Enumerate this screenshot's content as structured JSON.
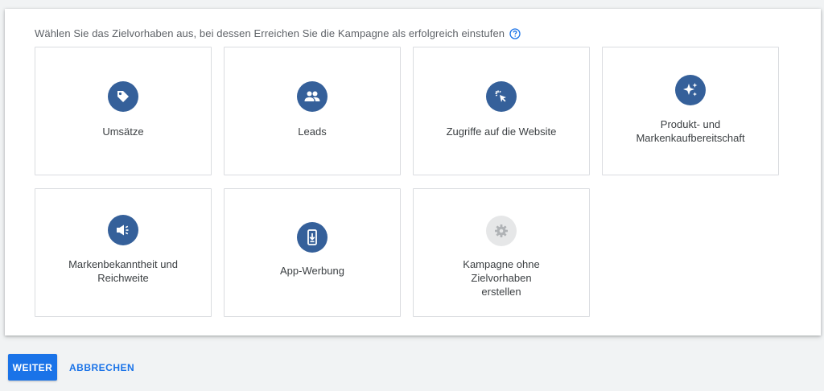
{
  "heading": "Wählen Sie das Zielvorhaben aus, bei dessen Erreichen Sie die Kampagne als erfolgreich einstufen",
  "help_icon": "help-circle-icon",
  "tiles": [
    {
      "label": "Umsätze",
      "icon": "tag-icon"
    },
    {
      "label": "Leads",
      "icon": "people-icon"
    },
    {
      "label": "Zugriffe auf die Website",
      "icon": "cursor-click-icon"
    },
    {
      "label": "Produkt- und\nMarkenkaufbereitschaft",
      "icon": "sparkle-icon"
    },
    {
      "label": "Markenbekanntheit und\nReichweite",
      "icon": "megaphone-icon"
    },
    {
      "label": "App-Werbung",
      "icon": "phone-download-icon"
    },
    {
      "label": "Kampagne ohne Zielvorhaben\nerstellen",
      "icon": "gear-icon"
    }
  ],
  "actions": {
    "continue_label": "WEITER",
    "cancel_label": "ABBRECHEN"
  },
  "colors": {
    "icon_circle": "#35609a",
    "icon_circle_disabled": "#e6e7e8",
    "primary": "#1a73e8"
  }
}
